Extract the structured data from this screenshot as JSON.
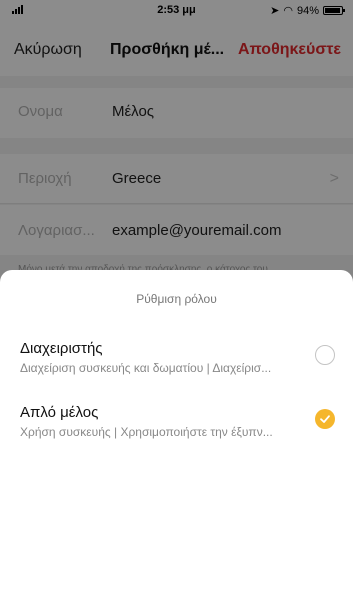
{
  "status_bar": {
    "time": "2:53 μμ",
    "battery": "94%",
    "icons": [
      "signal-icon",
      "location-icon",
      "wifi-icon",
      "battery-icon"
    ]
  },
  "nav": {
    "cancel_label": "Ακύρωση",
    "title": "Προσθήκη μέ...",
    "save_label": "Αποθηκεύστε",
    "save_color": "#e0282d"
  },
  "form": {
    "name": {
      "label": "Ονομα",
      "value": "Μέλος"
    },
    "region": {
      "label": "Περιοχή",
      "value": "Greece"
    },
    "account": {
      "label": "Λογαριασ...",
      "value": "example@youremail.com"
    },
    "note": "Μόνο μετά την αποδοχή της πρόσκλησης, ο κάτοχος του..."
  },
  "sheet": {
    "title": "Ρύθμιση ρόλου",
    "options": [
      {
        "title": "Διαχειριστής",
        "description": "Διαχείριση συσκευής και δωματίου | Διαχείρισ...",
        "selected": false
      },
      {
        "title": "Απλό μέλος",
        "description": "Χρήση συσκευής | Χρησιμοποιήστε την έξυπν...",
        "selected": true
      }
    ],
    "accent_color": "#f5b62c"
  }
}
